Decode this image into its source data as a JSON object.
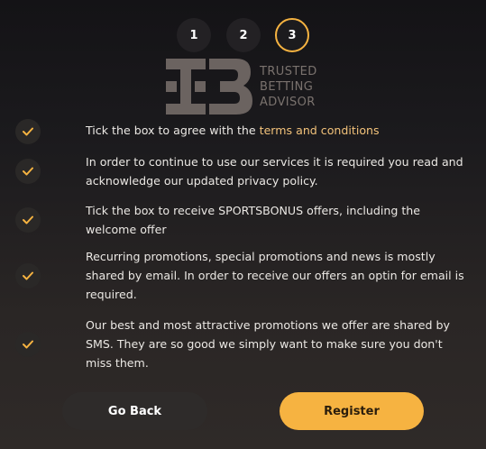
{
  "steps": [
    {
      "label": "1",
      "active": false
    },
    {
      "label": "2",
      "active": false
    },
    {
      "label": "3",
      "active": true
    }
  ],
  "logo": {
    "line1": "TRUSTED",
    "line2": "BETTING",
    "line3": "ADVISOR"
  },
  "consents": [
    {
      "text_before": "Tick the box to agree with the ",
      "link": "terms and conditions",
      "checked": true
    },
    {
      "text": "In order to continue to use our services it is required you read and acknowledge our updated privacy policy.",
      "checked": true
    },
    {
      "text": "Tick the box to receive SPORTSBONUS offers, including the welcome offer",
      "checked": true
    },
    {
      "text": "Recurring promotions, special promotions and news is mostly shared by email. In order to receive our offers an optin for email is required.",
      "checked": true
    },
    {
      "text": "Our best and most attractive promotions we offer are shared by SMS. They are so good we simply want to make sure you don't miss them.",
      "checked": true
    }
  ],
  "buttons": {
    "back": "Go Back",
    "register": "Register"
  },
  "colors": {
    "accent": "#f6b341",
    "link": "#f2c27a",
    "background": "#1b1a1d"
  }
}
